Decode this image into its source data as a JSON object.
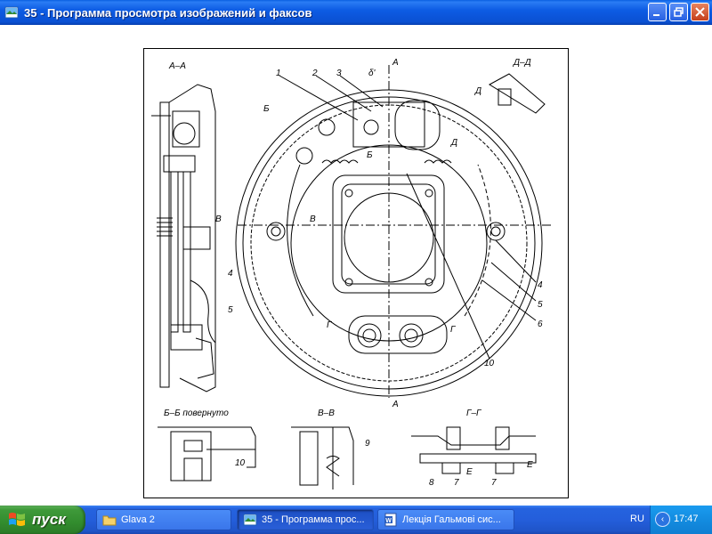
{
  "window": {
    "title": "35 - Программа просмотра изображений и факсов",
    "minimize_icon": "minimize-icon",
    "maximize_icon": "restore-icon",
    "close_icon": "close-icon"
  },
  "drawing": {
    "sections": {
      "aa": "А–А",
      "dd": "Д–Д",
      "bb": "Б–Б повернуто",
      "vv": "В–В",
      "gg": "Г–Г"
    },
    "callouts": {
      "n1": "1",
      "n2": "2",
      "n3": "3",
      "n4": "4",
      "n5": "5",
      "n6": "6",
      "n7": "7",
      "n8": "8",
      "n9": "9",
      "n10": "10",
      "n4b": "4",
      "n5b": "5",
      "n10b": "10",
      "n7b": "7"
    },
    "markers": {
      "a_top": "А",
      "a_bottom": "А",
      "b": "Б",
      "b2": "Б",
      "v_left": "В",
      "v_right": "В",
      "g_left": "Г",
      "g_right": "Г",
      "d1": "Д",
      "d2": "Д",
      "delta": "δ'",
      "e1": "Е",
      "e2": "Е"
    }
  },
  "toolbar": {
    "buttons": [
      "previous-image",
      "next-image",
      "best-fit",
      "actual-size",
      "slideshow",
      "zoom-in",
      "zoom-out",
      "rotate-clockwise",
      "rotate-counterclockwise",
      "delete",
      "print",
      "copy-to",
      "open-for-editing",
      "help"
    ]
  },
  "taskbar": {
    "start_label": "пуск",
    "tasks": [
      {
        "label": "Glava 2",
        "icon": "folder-icon"
      },
      {
        "label": "35 - Программа прос...",
        "icon": "image-viewer-icon"
      },
      {
        "label": "Лекція Гальмові сис...",
        "icon": "word-icon"
      }
    ],
    "language": "RU",
    "clock": "17:47"
  },
  "colors": {
    "titlebar": "#0a50d2",
    "taskbar": "#245edb",
    "start_button": "#3f9a3a",
    "tray": "#138ce0"
  }
}
